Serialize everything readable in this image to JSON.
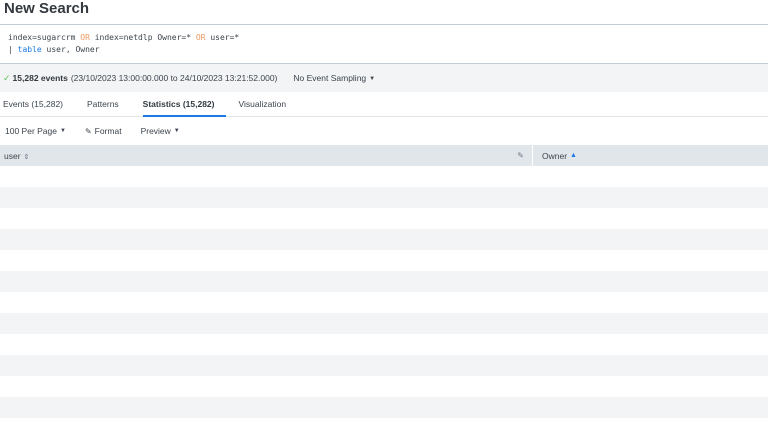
{
  "page": {
    "title": "New Search"
  },
  "search": {
    "line1": [
      {
        "text": "index=sugarcrm ",
        "type": "plain"
      },
      {
        "text": "OR",
        "type": "kw"
      },
      {
        "text": " index=netdlp Owner=* ",
        "type": "plain"
      },
      {
        "text": "OR",
        "type": "kw"
      },
      {
        "text": " user=*",
        "type": "plain"
      }
    ],
    "line2": [
      {
        "text": "| ",
        "type": "plain"
      },
      {
        "text": "table",
        "type": "cmd"
      },
      {
        "text": " user, Owner",
        "type": "plain"
      }
    ]
  },
  "status": {
    "check_icon": "check-icon",
    "event_count": "15,282 events",
    "time_range": "(23/10/2023 13:00:00.000 to 24/10/2023 13:21:52.000)",
    "sampling": "No Event Sampling"
  },
  "tabs": [
    {
      "label": "Events (15,282)",
      "active": false
    },
    {
      "label": "Patterns",
      "active": false
    },
    {
      "label": "Statistics (15,282)",
      "active": true
    },
    {
      "label": "Visualization",
      "active": false
    }
  ],
  "toolbar": {
    "per_page": "100 Per Page",
    "format": "Format",
    "preview": "Preview"
  },
  "table": {
    "columns": [
      {
        "label": "user",
        "sort": "unsorted"
      },
      {
        "label": "Owner",
        "sort": "ascending"
      }
    ],
    "row_count": 13
  },
  "colors": {
    "accent": "#1c7ae5",
    "keyword": "#ec9960",
    "success": "#5cc05c",
    "header_bg": "#e1e6eb",
    "stripe_bg": "#f2f4f5"
  }
}
